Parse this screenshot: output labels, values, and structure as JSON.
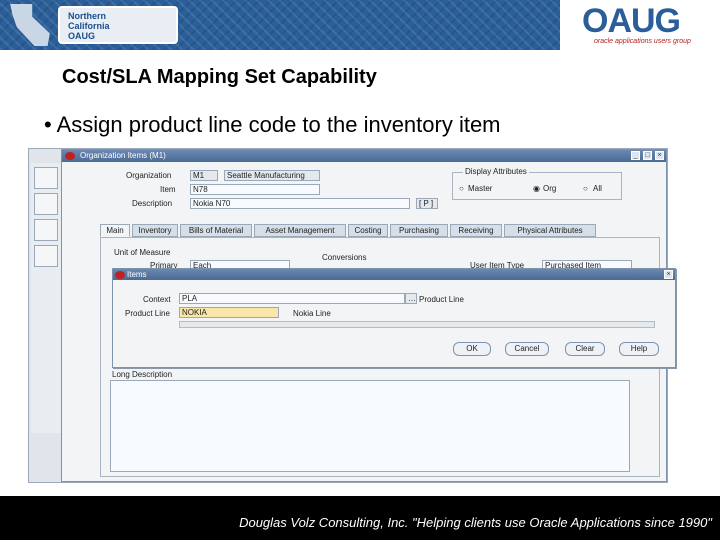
{
  "banner": {
    "chapter_logo": "Northern California OAUG",
    "oaug_logo": "OAUG",
    "oaug_tagline": "oracle applications users group"
  },
  "slide": {
    "title": "Cost/SLA Mapping Set Capability",
    "bullet": "• Assign product line code to the inventory item"
  },
  "window": {
    "title": "Organization Items (M1)",
    "organization_label": "Organization",
    "organization_code": "M1",
    "organization_name": "Seattle Manufacturing",
    "item_label": "Item",
    "item_value": "N78",
    "description_label": "Description",
    "description_value": "Nokia N70",
    "flag": "[ P ]",
    "display_attributes_label": "Display Attributes",
    "radio_master": "Master",
    "radio_org": "Org",
    "radio_all": "All",
    "tabs": [
      "Main",
      "Inventory",
      "Bills of Material",
      "Asset Management",
      "Costing",
      "Purchasing",
      "Receiving",
      "Physical Attributes"
    ],
    "unit_of_measure_label": "Unit of Measure",
    "primary_label": "Primary",
    "primary_value": "Each",
    "conversions_label": "Conversions",
    "user_item_type_label": "User Item Type",
    "user_item_type_value": "Purchased Item",
    "long_description_label": "Long Description"
  },
  "dialog": {
    "title": "Items",
    "context_label": "Context",
    "context_value": "PLA",
    "product_line_label": "Product Line",
    "product_line_value": "NOKIA",
    "product_line_desc": "Nokia Line",
    "buttons": [
      "OK",
      "Cancel",
      "Clear",
      "Help"
    ]
  },
  "footer": {
    "text": "Douglas Volz Consulting, Inc. \"Helping clients use Oracle Applications since 1990\""
  }
}
